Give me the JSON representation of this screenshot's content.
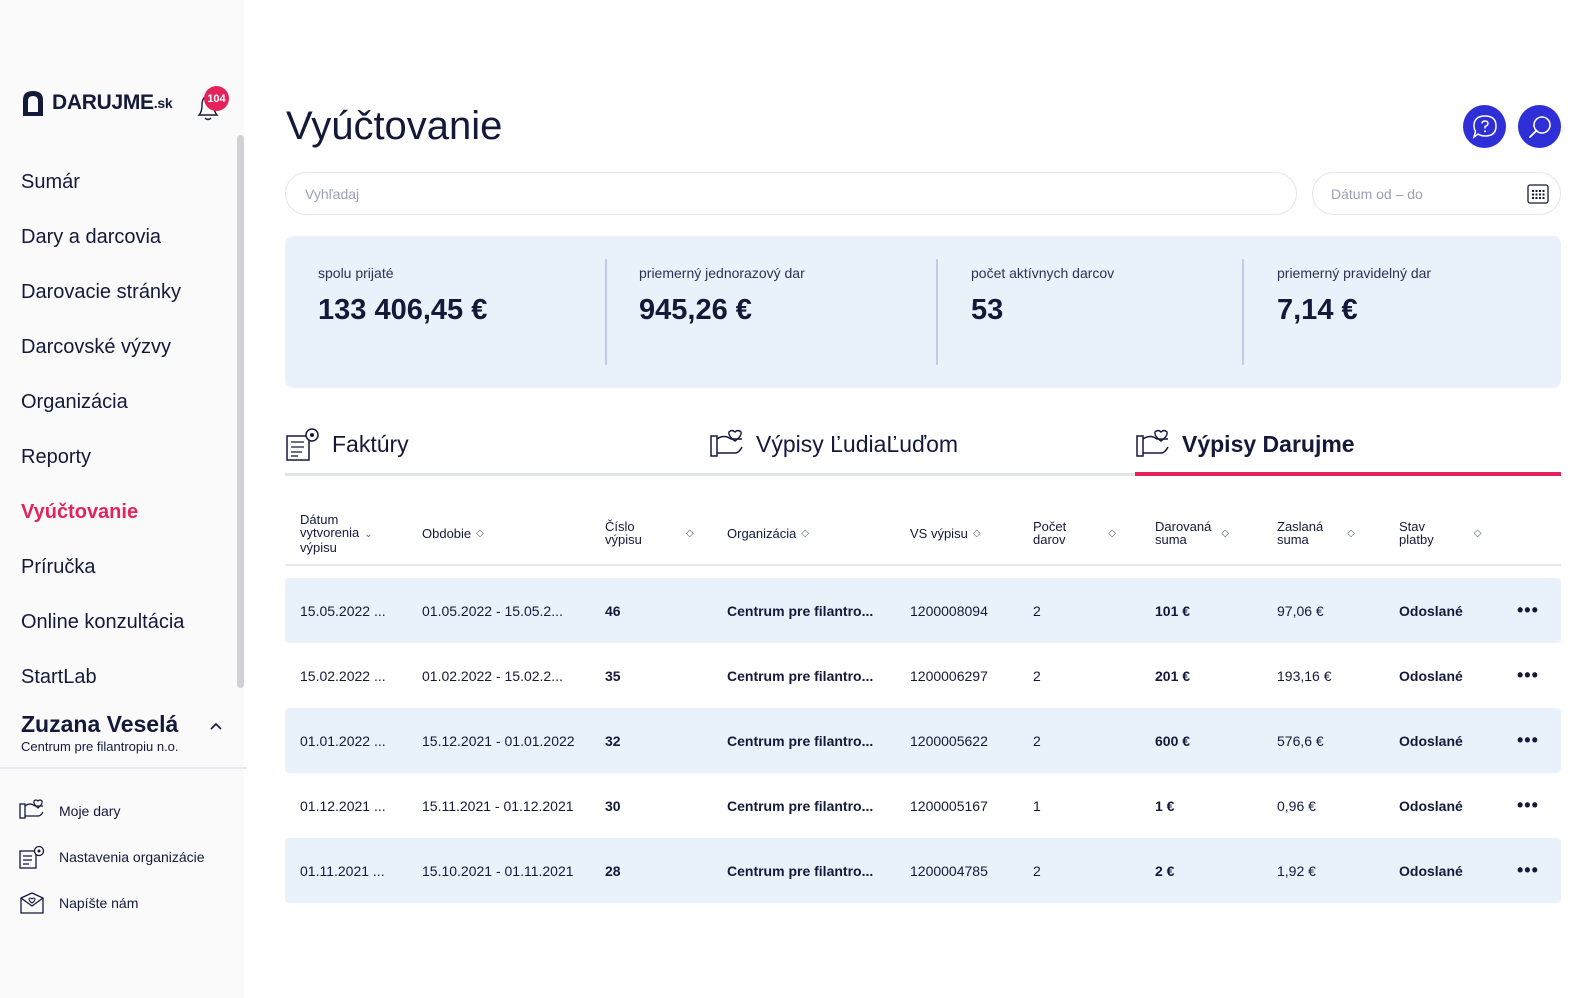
{
  "app": {
    "brand": "DARUJME",
    "brand_suffix": ".sk",
    "notification_count": "104"
  },
  "sidebar": {
    "items": [
      {
        "label": "Sumár"
      },
      {
        "label": "Dary a darcovia"
      },
      {
        "label": "Darovacie stránky"
      },
      {
        "label": "Darcovské výzvy"
      },
      {
        "label": "Organizácia"
      },
      {
        "label": "Reporty"
      },
      {
        "label": "Vyúčtovanie",
        "active": true
      },
      {
        "label": "Príručka"
      },
      {
        "label": "Online konzultácia"
      },
      {
        "label": "StartLab"
      }
    ],
    "user": {
      "name": "Zuzana Veselá",
      "organization": "Centrum pre filantropiu n.o."
    },
    "sub_items": [
      {
        "label": "Moje dary",
        "icon": "hand-heart-icon"
      },
      {
        "label": "Nastavenia organizácie",
        "icon": "settings-document-icon"
      },
      {
        "label": "Napíšte nám",
        "icon": "mail-heart-icon"
      }
    ]
  },
  "header": {
    "title": "Vyúčtovanie",
    "help_icon": "help-chat-icon",
    "search_icon": "search-icon"
  },
  "filters": {
    "search_placeholder": "Vyhľadaj",
    "date_placeholder": "Dátum od – do"
  },
  "stats": [
    {
      "label": "spolu prijaté",
      "value": "133 406,45 €"
    },
    {
      "label": "priemerný jednorazový dar",
      "value": "945,26 €"
    },
    {
      "label": "počet aktívnych darcov",
      "value": "53"
    },
    {
      "label": "priemerný pravidelný dar",
      "value": "7,14 €"
    }
  ],
  "tabs": [
    {
      "label": "Faktúry"
    },
    {
      "label": "Výpisy ĽudiaĽuďom"
    },
    {
      "label": "Výpisy Darujme",
      "active": true
    }
  ],
  "table": {
    "columns": [
      {
        "label": "Dátum vytvorenia výpisu",
        "lines": [
          "Dátum",
          "vytvorenia",
          "výpisu"
        ]
      },
      {
        "label": "Obdobie"
      },
      {
        "label": "Číslo výpisu",
        "lines": [
          "Číslo",
          "výpisu"
        ]
      },
      {
        "label": "Organizácia"
      },
      {
        "label": "VS výpisu"
      },
      {
        "label": "Počet darov",
        "lines": [
          "Počet",
          "darov"
        ]
      },
      {
        "label": "Darovaná suma",
        "lines": [
          "Darovaná",
          "suma"
        ]
      },
      {
        "label": "Zaslaná suma",
        "lines": [
          "Zaslaná",
          "suma"
        ]
      },
      {
        "label": "Stav platby",
        "lines": [
          "Stav",
          "platby"
        ]
      }
    ],
    "rows": [
      {
        "date": "15.05.2022 ...",
        "period": "01.05.2022 - 15.05.2...",
        "number": "46",
        "org": "Centrum pre filantro...",
        "vs": "1200008094",
        "count": "2",
        "donated": "101 €",
        "sent": "97,06 €",
        "status": "Odoslané"
      },
      {
        "date": "15.02.2022 ...",
        "period": "01.02.2022 - 15.02.2...",
        "number": "35",
        "org": "Centrum pre filantro...",
        "vs": "1200006297",
        "count": "2",
        "donated": "201 €",
        "sent": "193,16 €",
        "status": "Odoslané"
      },
      {
        "date": "01.01.2022 ...",
        "period": "15.12.2021 - 01.01.2022",
        "number": "32",
        "org": "Centrum pre filantro...",
        "vs": "1200005622",
        "count": "2",
        "donated": "600 €",
        "sent": "576,6 €",
        "status": "Odoslané"
      },
      {
        "date": "01.12.2021 ...",
        "period": "15.11.2021 - 01.12.2021",
        "number": "30",
        "org": "Centrum pre filantro...",
        "vs": "1200005167",
        "count": "1",
        "donated": "1 €",
        "sent": "0,96 €",
        "status": "Odoslané"
      },
      {
        "date": "01.11.2021 ...",
        "period": "15.10.2021 - 01.11.2021",
        "number": "28",
        "org": "Centrum pre filantro...",
        "vs": "1200004785",
        "count": "2",
        "donated": "2 €",
        "sent": "1,92 €",
        "status": "Odoslané"
      }
    ],
    "more_label": "•••"
  },
  "colors": {
    "accent": "#e5235a",
    "primary": "#2f2fd8",
    "text": "#14193a",
    "panel": "#e9f1fb"
  }
}
